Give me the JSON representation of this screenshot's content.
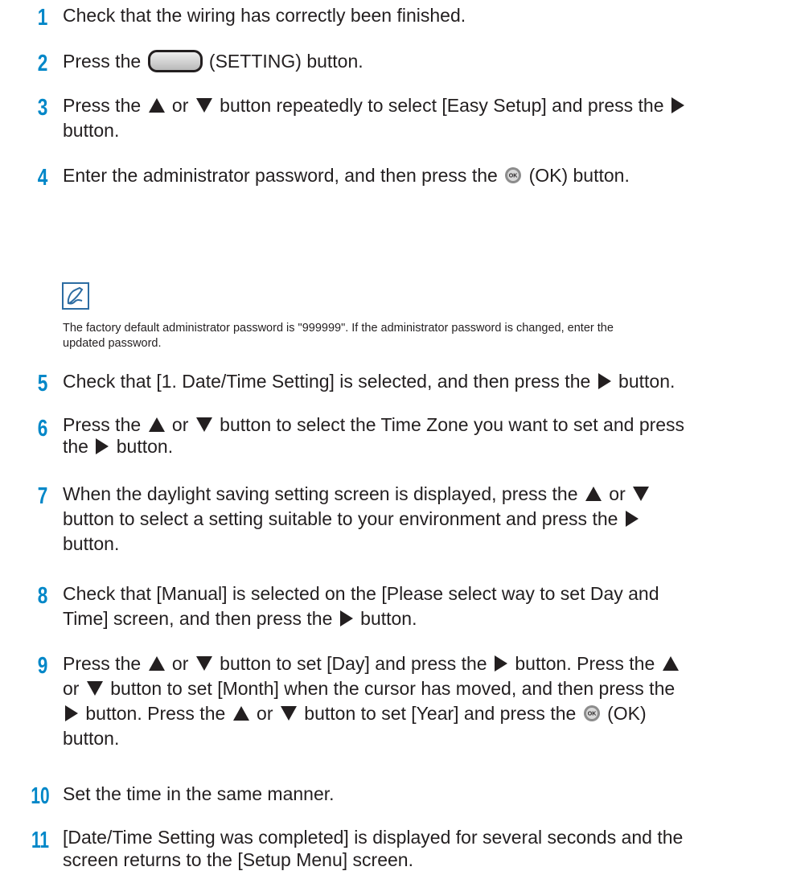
{
  "steps": [
    {
      "number": "1",
      "text": "Check that the wiring has correctly been finished."
    },
    {
      "number": "2",
      "before": "Press the ",
      "button_icon": "setting-button-icon",
      "after": " (SETTING) button."
    },
    {
      "number": "3",
      "p1": "Press the ",
      "p2": " or ",
      "p3": " button repeatedly to select [Easy Setup] and press the ",
      "line2": "button."
    },
    {
      "number": "4",
      "before": "Enter the administrator password, and then press the ",
      "after": " (OK) button."
    },
    {
      "number": "5",
      "before": "Check that [1. Date/Time Setting] is selected, and then press the ",
      "after": " button."
    },
    {
      "number": "6",
      "p1": "Press the ",
      "p2": " or ",
      "p3": " button to select the Time Zone you want to set and press",
      "l2a": "the ",
      "l2b": " button."
    },
    {
      "number": "7",
      "l1a": "When the daylight saving setting screen is displayed, press the ",
      "l1b": " or ",
      "l2": "button to select a setting suitable to your environment and press the ",
      "l3": "button."
    },
    {
      "number": "8",
      "l1": "Check that [Manual] is selected on the [Please select way to set Day and",
      "l2a": "Time] screen, and then press the ",
      "l2b": " button."
    },
    {
      "number": "9",
      "l1a": "Press the ",
      "l1b": " or ",
      "l1c": " button to set [Day] and press the ",
      "l1d": " button. Press the ",
      "l2a": "or ",
      "l2b": " button to set [Month] when the cursor has moved, and then press the",
      "l3a": " button. Press the ",
      "l3b": " or ",
      "l3c": " button to set [Year] and press the ",
      "l3d": " (OK)",
      "l4": "button."
    },
    {
      "number": "10",
      "text": "Set the time in the same manner."
    },
    {
      "number": "11",
      "l1": "[Date/Time Setting was completed] is displayed for several seconds and the",
      "l2": "screen returns to the [Setup Menu] screen."
    }
  ],
  "note": {
    "icon": "memo-pencil-icon",
    "l1": "The factory default administrator password is \"999999\". If the administrator password is changed, enter the",
    "l2": "updated password."
  },
  "colors": {
    "step_number": "#0087c8",
    "text": "#231f20",
    "note_icon": "#2c6ca2"
  },
  "icons": {
    "up": "up-arrow-icon",
    "down": "down-arrow-icon",
    "right": "right-arrow-icon",
    "ok": "ok-button-icon",
    "setting": "setting-button-icon"
  }
}
